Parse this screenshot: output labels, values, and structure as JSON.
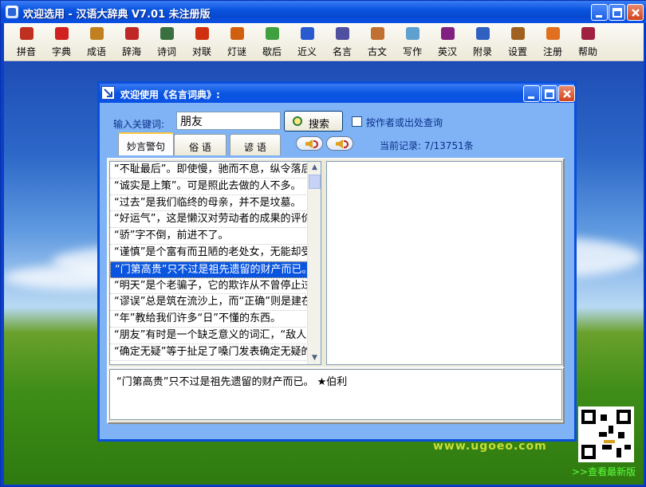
{
  "window": {
    "title": "欢迎选用 - 汉语大辞典 V7.01 未注册版"
  },
  "toolbar": [
    {
      "label": "拼音",
      "icon": "person-icon",
      "color": "#c03020"
    },
    {
      "label": "字典",
      "icon": "book-red-icon",
      "color": "#d02020"
    },
    {
      "label": "成语",
      "icon": "books-icon",
      "color": "#c08020"
    },
    {
      "label": "辞海",
      "icon": "book-stack-icon",
      "color": "#c02828"
    },
    {
      "label": "诗词",
      "icon": "scroll-icon",
      "color": "#3a7040"
    },
    {
      "label": "对联",
      "icon": "couplet-icon",
      "color": "#d03010"
    },
    {
      "label": "灯谜",
      "icon": "lantern-icon",
      "color": "#d06010"
    },
    {
      "label": "歇后",
      "icon": "cards-icon",
      "color": "#40a040"
    },
    {
      "label": "近义",
      "icon": "open-book-icon",
      "color": "#2a5ad0"
    },
    {
      "label": "名言",
      "icon": "notepad-icon",
      "color": "#5050a0"
    },
    {
      "label": "古文",
      "icon": "bookshelf-icon",
      "color": "#c07030"
    },
    {
      "label": "写作",
      "icon": "pen-icon",
      "color": "#60a0d0"
    },
    {
      "label": "英汉",
      "icon": "dictionary-icon",
      "color": "#802080"
    },
    {
      "label": "附录",
      "icon": "appendix-icon",
      "color": "#3060c0"
    },
    {
      "label": "设置",
      "icon": "gear-icon",
      "color": "#a06020"
    },
    {
      "label": "注册",
      "icon": "register-icon",
      "color": "#e07020"
    },
    {
      "label": "帮助",
      "icon": "help-book-icon",
      "color": "#a02040"
    }
  ],
  "dialog": {
    "title": "欢迎使用《名言词典》:",
    "keyword_label": "输入关键词:",
    "keyword_value": "朋友",
    "search_label": "搜索",
    "author_checkbox_label": "按作者或出处查询",
    "tabs": [
      "妙言警句",
      "俗  语",
      "谚  语"
    ],
    "record": "当前记录: 7/13751条",
    "list": [
      "“不耻最后”。即使慢，驰而不息，纵令落后，纵令失败，但一定可以达到他所向的目标。",
      "“诚实是上策”。可是照此去做的人不多。",
      "“过去”是我们临终的母亲，并不是坟墓。",
      "“好运气”，这是懒汉对劳动者的成果的评价。",
      "“骄”字不倒，前进不了。",
      "“谨慎”是个富有而丑陋的老处女，无能却受人追求。",
      "“门第高贵”只不过是祖先遗留的财产而已。",
      "“明天”是个老骗子，它的欺诈从不曾停止过。",
      "“谬误”总是筑在流沙上，而“正确”则是建在磐石上。",
      "“年”教给我们许多“日”不懂的东西。",
      "“朋友”有时是一个缺乏意义的词汇，“敌人”却从不是。",
      "“确定无疑”等于扯足了嗓门发表确定无疑的说法。"
    ],
    "selected_index": 6,
    "quote": "“门第高贵”只不过是祖先遗留的财产而已。 ★伯利"
  },
  "footer": {
    "latest_link": ">>查看最新版",
    "watermark": "www.ugoeo.com"
  }
}
